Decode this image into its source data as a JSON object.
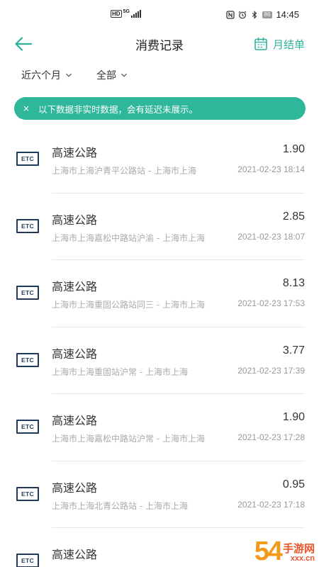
{
  "status_bar": {
    "hd": "HD",
    "network": "5G",
    "battery": "86",
    "time": "14:45"
  },
  "header": {
    "title": "消费记录",
    "monthly_label": "月结单",
    "back_icon": "arrow-left-icon",
    "monthly_icon": "calendar-icon"
  },
  "filters": {
    "period": "近六个月",
    "category": "全部"
  },
  "banner": {
    "close": "×",
    "text": "以下数据非实时数据，会有延迟未展示。"
  },
  "records": [
    {
      "icon": "ETC",
      "title": "高速公路",
      "amount": "1.90",
      "location": "上海市上海沪青平公路站 - 上海市上海",
      "time": "2021-02-23 18:14"
    },
    {
      "icon": "ETC",
      "title": "高速公路",
      "amount": "2.85",
      "location": "上海市上海嘉松中路站沪渝 - 上海市上海",
      "time": "2021-02-23 18:07"
    },
    {
      "icon": "ETC",
      "title": "高速公路",
      "amount": "8.13",
      "location": "上海市上海重固公路站同三 - 上海市上海",
      "time": "2021-02-23 17:53"
    },
    {
      "icon": "ETC",
      "title": "高速公路",
      "amount": "3.77",
      "location": "上海市上海重固站沪常 - 上海市上海",
      "time": "2021-02-23 17:39"
    },
    {
      "icon": "ETC",
      "title": "高速公路",
      "amount": "1.90",
      "location": "上海市上海嘉松中路站沪常 - 上海市上海",
      "time": "2021-02-23 17:28"
    },
    {
      "icon": "ETC",
      "title": "高速公路",
      "amount": "0.95",
      "location": "上海市上海北青公路站 - 上海市上海",
      "time": "2021-02-23 17:18"
    },
    {
      "icon": "ETC",
      "title": "高速公路",
      "amount": "",
      "location": "",
      "time": ""
    }
  ],
  "watermark": {
    "digits": "54",
    "site": "手游网",
    "url": "xxx.cn"
  },
  "colors": {
    "accent": "#2db39c",
    "banner": "#2fb79b",
    "etc_icon": "#1f3a5a"
  }
}
